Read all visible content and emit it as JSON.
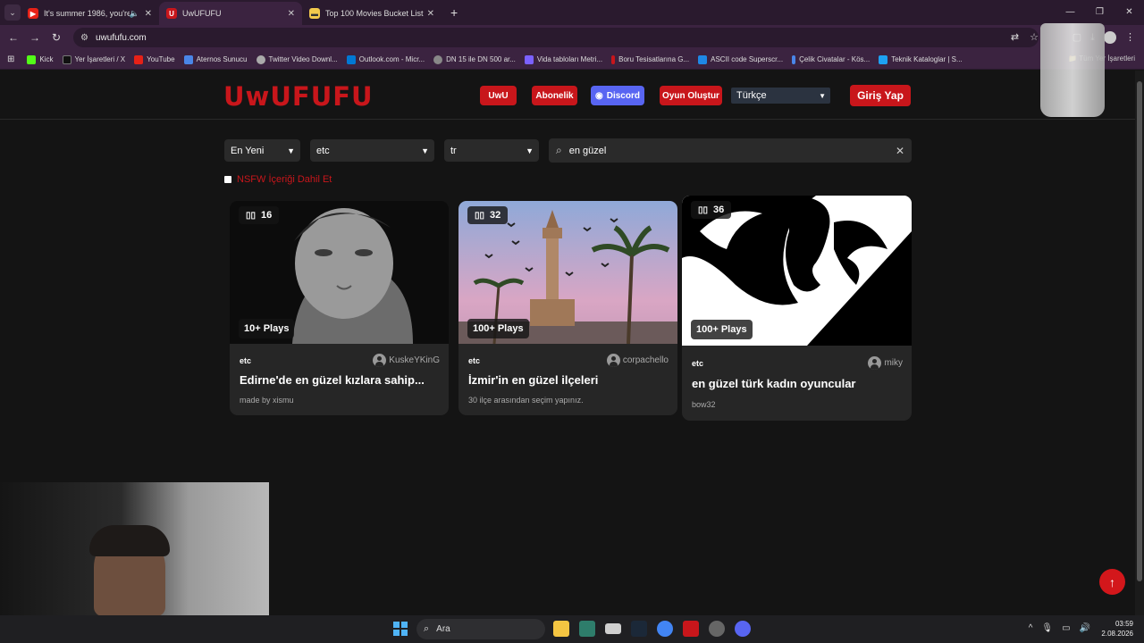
{
  "browser": {
    "tabs": [
      {
        "title": "It's summer 1986, you're d",
        "favicon_color": "#e62117",
        "favicon": "▶"
      },
      {
        "title": "UwUFUFU",
        "favicon_color": "#c8161b",
        "favicon": "U"
      },
      {
        "title": "Top 100 Movies Bucket List",
        "favicon_color": "#f2c94c",
        "favicon": "▬"
      }
    ],
    "url": "uwufufu.com",
    "bookmarks": [
      "Kick",
      "Yer İşaretleri / X",
      "YouTube",
      "Aternos Sunucu",
      "Twitter Video Downl...",
      "Outlook.com - Micr...",
      "DN 15 ile DN 500 ar...",
      "Vida tabloları Metri...",
      "Boru Tesisatlarına G...",
      "ASCII code Superscr...",
      "Çelik Civatalar - Kös...",
      "Teknik Kataloglar | S..."
    ],
    "bookmark_colors": [
      "#53fc18",
      "#111111",
      "#e62117",
      "#4a86e8",
      "#aaaaaa",
      "#0078d4",
      "#888888",
      "#7b61ff",
      "#c8161b",
      "#1e88e5",
      "#4a86e8",
      "#1da1f2"
    ],
    "bookmarks_folder": "Tüm Yer İşaretleri"
  },
  "site": {
    "logo": "UwUFUFU",
    "nav": {
      "uwu": "UwU",
      "subscription": "Abonelik",
      "discord": "Discord",
      "create_game": "Oyun Oluştur",
      "login": "Giriş Yap"
    },
    "language": "Türkçe",
    "filters": {
      "sort": "En Yeni",
      "category": "etc",
      "locale": "tr"
    },
    "search": {
      "value": "en güzel"
    },
    "nsfw_label": "NSFW İçeriği Dahil Et"
  },
  "cards": [
    {
      "count": "16",
      "plays": "10+ Plays",
      "category": "etc",
      "author": "KuskeYKinG",
      "title": "Edirne'de en güzel kızlara sahip...",
      "description": "made by xismu"
    },
    {
      "count": "32",
      "plays": "100+ Plays",
      "category": "etc",
      "author": "corpachello",
      "title": "İzmir'in en güzel ilçeleri",
      "description": "30 ilçe arasından seçim yapınız."
    },
    {
      "count": "36",
      "plays": "100+ Plays",
      "category": "etc",
      "author": "miky",
      "title": "en güzel türk kadın oyuncular",
      "description": "bow32"
    }
  ],
  "taskbar": {
    "search_placeholder": "Ara",
    "time": "03:59",
    "date": "2.08.2026"
  }
}
